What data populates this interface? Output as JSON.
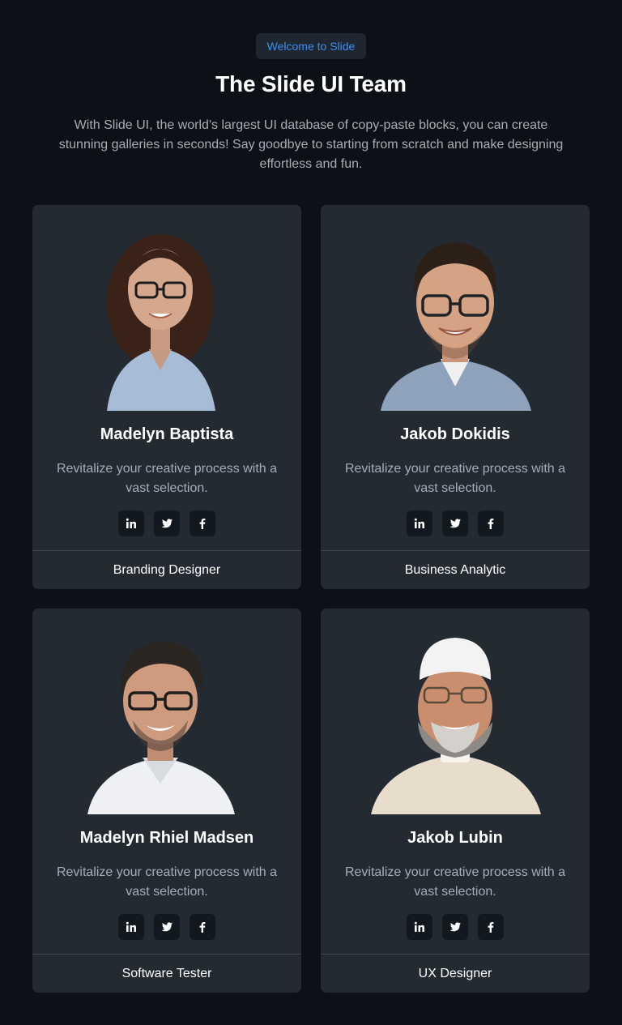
{
  "header": {
    "badge": "Welcome to Slide",
    "title": "The Slide UI Team",
    "subtitle": "With Slide UI, the world's largest UI database of copy-paste blocks, you can create stunning galleries in seconds! Say goodbye to starting from scratch and make designing effortless and fun."
  },
  "colors": {
    "background": "#0d1117",
    "card": "#232a31",
    "accent": "#3b8ff0",
    "muted_text": "#a5adb8"
  },
  "members": [
    {
      "name": "Madelyn Baptista",
      "description": "Revitalize your creative process with a vast selection.",
      "role": "Branding Designer",
      "socials": [
        "linkedin-icon",
        "twitter-icon",
        "facebook-icon"
      ]
    },
    {
      "name": "Jakob Dokidis",
      "description": "Revitalize your creative process with a vast selection.",
      "role": "Business Analytic",
      "socials": [
        "linkedin-icon",
        "twitter-icon",
        "facebook-icon"
      ]
    },
    {
      "name": "Madelyn Rhiel Madsen",
      "description": "Revitalize your creative process with a vast selection.",
      "role": "Software Tester",
      "socials": [
        "linkedin-icon",
        "twitter-icon",
        "facebook-icon"
      ]
    },
    {
      "name": "Jakob Lubin",
      "description": "Revitalize your creative process with a vast selection.",
      "role": "UX Designer",
      "socials": [
        "linkedin-icon",
        "twitter-icon",
        "facebook-icon"
      ]
    }
  ]
}
